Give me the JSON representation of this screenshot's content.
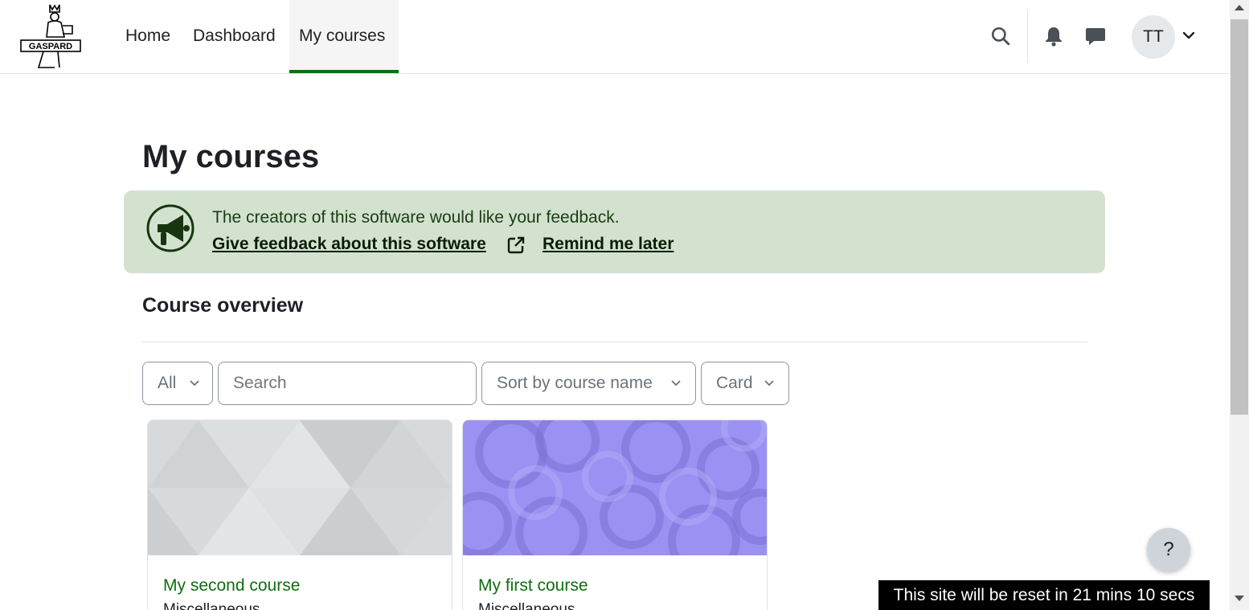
{
  "nav": {
    "logo_text": "GASPARD",
    "links": [
      {
        "label": "Home"
      },
      {
        "label": "Dashboard"
      },
      {
        "label": "My courses",
        "active": true
      }
    ],
    "icons": [
      "search-icon",
      "bell-icon",
      "chat-icon",
      "chevron-down-icon"
    ],
    "avatar_initials": "TT"
  },
  "page": {
    "title": "My courses"
  },
  "feedback": {
    "message": "The creators of this software would like your feedback.",
    "give_feedback_label": "Give feedback about this software",
    "remind_later_label": "Remind me later",
    "icon": "megaphone-icon",
    "bg_color": "#d2e2cf"
  },
  "course_overview": {
    "title": "Course overview",
    "filter_value": "All",
    "search_placeholder": "Search",
    "sort_value": "Sort by course name",
    "view_value": "Card",
    "courses": [
      {
        "name": "My second course",
        "category": "Miscellaneous"
      },
      {
        "name": "My first course",
        "category": "Miscellaneous"
      }
    ]
  },
  "help": {
    "label": "?"
  },
  "reset_notice": "This site will be reset in 21 mins 10 secs",
  "colors": {
    "accent": "#0f6e0f",
    "text": "#1d2125"
  }
}
